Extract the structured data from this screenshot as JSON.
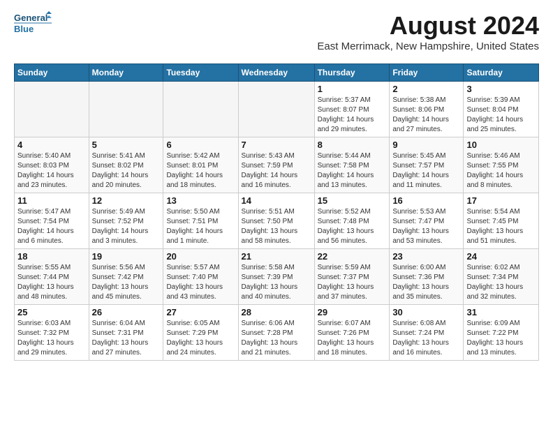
{
  "logo": {
    "line1": "General",
    "line2": "Blue"
  },
  "title": "August 2024",
  "subtitle": "East Merrimack, New Hampshire, United States",
  "weekdays": [
    "Sunday",
    "Monday",
    "Tuesday",
    "Wednesday",
    "Thursday",
    "Friday",
    "Saturday"
  ],
  "weeks": [
    [
      {
        "day": "",
        "detail": ""
      },
      {
        "day": "",
        "detail": ""
      },
      {
        "day": "",
        "detail": ""
      },
      {
        "day": "",
        "detail": ""
      },
      {
        "day": "1",
        "detail": "Sunrise: 5:37 AM\nSunset: 8:07 PM\nDaylight: 14 hours\nand 29 minutes."
      },
      {
        "day": "2",
        "detail": "Sunrise: 5:38 AM\nSunset: 8:06 PM\nDaylight: 14 hours\nand 27 minutes."
      },
      {
        "day": "3",
        "detail": "Sunrise: 5:39 AM\nSunset: 8:04 PM\nDaylight: 14 hours\nand 25 minutes."
      }
    ],
    [
      {
        "day": "4",
        "detail": "Sunrise: 5:40 AM\nSunset: 8:03 PM\nDaylight: 14 hours\nand 23 minutes."
      },
      {
        "day": "5",
        "detail": "Sunrise: 5:41 AM\nSunset: 8:02 PM\nDaylight: 14 hours\nand 20 minutes."
      },
      {
        "day": "6",
        "detail": "Sunrise: 5:42 AM\nSunset: 8:01 PM\nDaylight: 14 hours\nand 18 minutes."
      },
      {
        "day": "7",
        "detail": "Sunrise: 5:43 AM\nSunset: 7:59 PM\nDaylight: 14 hours\nand 16 minutes."
      },
      {
        "day": "8",
        "detail": "Sunrise: 5:44 AM\nSunset: 7:58 PM\nDaylight: 14 hours\nand 13 minutes."
      },
      {
        "day": "9",
        "detail": "Sunrise: 5:45 AM\nSunset: 7:57 PM\nDaylight: 14 hours\nand 11 minutes."
      },
      {
        "day": "10",
        "detail": "Sunrise: 5:46 AM\nSunset: 7:55 PM\nDaylight: 14 hours\nand 8 minutes."
      }
    ],
    [
      {
        "day": "11",
        "detail": "Sunrise: 5:47 AM\nSunset: 7:54 PM\nDaylight: 14 hours\nand 6 minutes."
      },
      {
        "day": "12",
        "detail": "Sunrise: 5:49 AM\nSunset: 7:52 PM\nDaylight: 14 hours\nand 3 minutes."
      },
      {
        "day": "13",
        "detail": "Sunrise: 5:50 AM\nSunset: 7:51 PM\nDaylight: 14 hours\nand 1 minute."
      },
      {
        "day": "14",
        "detail": "Sunrise: 5:51 AM\nSunset: 7:50 PM\nDaylight: 13 hours\nand 58 minutes."
      },
      {
        "day": "15",
        "detail": "Sunrise: 5:52 AM\nSunset: 7:48 PM\nDaylight: 13 hours\nand 56 minutes."
      },
      {
        "day": "16",
        "detail": "Sunrise: 5:53 AM\nSunset: 7:47 PM\nDaylight: 13 hours\nand 53 minutes."
      },
      {
        "day": "17",
        "detail": "Sunrise: 5:54 AM\nSunset: 7:45 PM\nDaylight: 13 hours\nand 51 minutes."
      }
    ],
    [
      {
        "day": "18",
        "detail": "Sunrise: 5:55 AM\nSunset: 7:44 PM\nDaylight: 13 hours\nand 48 minutes."
      },
      {
        "day": "19",
        "detail": "Sunrise: 5:56 AM\nSunset: 7:42 PM\nDaylight: 13 hours\nand 45 minutes."
      },
      {
        "day": "20",
        "detail": "Sunrise: 5:57 AM\nSunset: 7:40 PM\nDaylight: 13 hours\nand 43 minutes."
      },
      {
        "day": "21",
        "detail": "Sunrise: 5:58 AM\nSunset: 7:39 PM\nDaylight: 13 hours\nand 40 minutes."
      },
      {
        "day": "22",
        "detail": "Sunrise: 5:59 AM\nSunset: 7:37 PM\nDaylight: 13 hours\nand 37 minutes."
      },
      {
        "day": "23",
        "detail": "Sunrise: 6:00 AM\nSunset: 7:36 PM\nDaylight: 13 hours\nand 35 minutes."
      },
      {
        "day": "24",
        "detail": "Sunrise: 6:02 AM\nSunset: 7:34 PM\nDaylight: 13 hours\nand 32 minutes."
      }
    ],
    [
      {
        "day": "25",
        "detail": "Sunrise: 6:03 AM\nSunset: 7:32 PM\nDaylight: 13 hours\nand 29 minutes."
      },
      {
        "day": "26",
        "detail": "Sunrise: 6:04 AM\nSunset: 7:31 PM\nDaylight: 13 hours\nand 27 minutes."
      },
      {
        "day": "27",
        "detail": "Sunrise: 6:05 AM\nSunset: 7:29 PM\nDaylight: 13 hours\nand 24 minutes."
      },
      {
        "day": "28",
        "detail": "Sunrise: 6:06 AM\nSunset: 7:28 PM\nDaylight: 13 hours\nand 21 minutes."
      },
      {
        "day": "29",
        "detail": "Sunrise: 6:07 AM\nSunset: 7:26 PM\nDaylight: 13 hours\nand 18 minutes."
      },
      {
        "day": "30",
        "detail": "Sunrise: 6:08 AM\nSunset: 7:24 PM\nDaylight: 13 hours\nand 16 minutes."
      },
      {
        "day": "31",
        "detail": "Sunrise: 6:09 AM\nSunset: 7:22 PM\nDaylight: 13 hours\nand 13 minutes."
      }
    ]
  ]
}
